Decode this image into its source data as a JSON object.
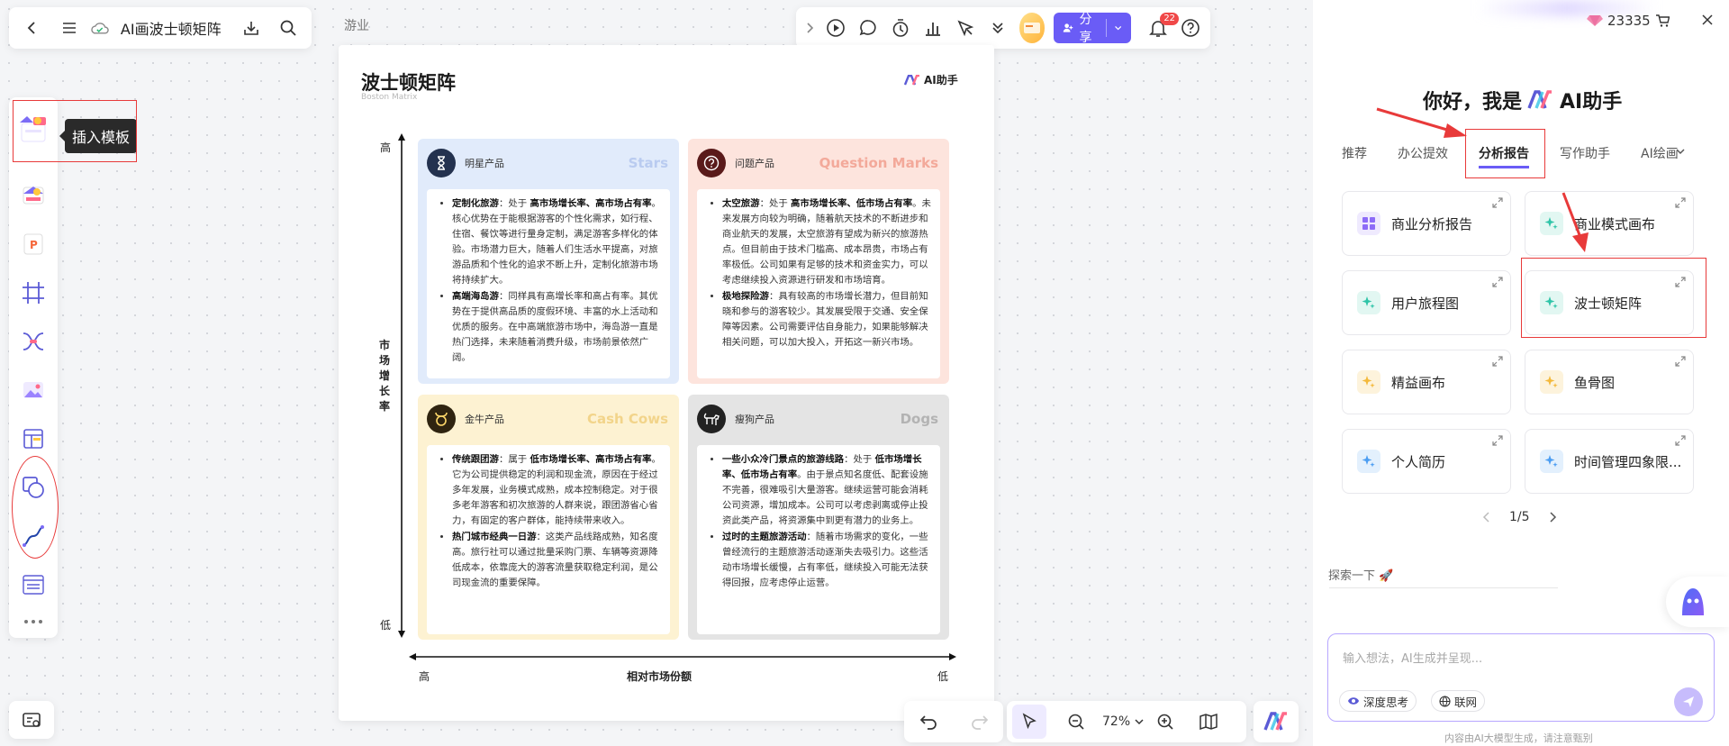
{
  "app": {
    "doc_title": "AI画波士顿矩阵",
    "behind_text": "游业"
  },
  "toolbar": {
    "share_label": "分享",
    "notification_count": "22"
  },
  "left_toolbar": {
    "tooltip": "插入模板"
  },
  "board": {
    "title": "波士顿矩阵",
    "subtitle": "Boston Matrix",
    "logo_text": "AI助手",
    "y_axis_label": "市场增长率",
    "y_high": "高",
    "y_low": "低",
    "x_axis_label": "相对市场份额",
    "x_high": "高",
    "x_low": "低",
    "quadrants": {
      "stars": {
        "name": "明星产品",
        "en": "Stars",
        "items": [
          {
            "title": "定制化旅游",
            "lead": "：处于 ",
            "highlight": "高市场增长率、高市场占有率",
            "rest": "。核心优势在于能根据游客的个性化需求，如行程、住宿、餐饮等进行量身定制，满足游客多样化的体验。市场潜力巨大，随着人们生活水平提高，对旅游品质和个性化的追求不断上升，定制化旅游市场将持续扩大。"
          },
          {
            "title": "高端海岛游",
            "lead": "：同样具有高增长率和高占有率。其优势在于提供高品质的度假环境、丰富的水上活动和优质的服务。在中高端旅游市场中，海岛游一直是热门选择，未来随着消费升级，市场前景依然广阔。",
            "highlight": "",
            "rest": ""
          }
        ]
      },
      "question_marks": {
        "name": "问题产品",
        "en": "Question Marks",
        "items": [
          {
            "title": "太空旅游",
            "lead": "：处于 ",
            "highlight": "高市场增长率、低市场占有率",
            "rest": "。未来发展方向较为明确，随着航天技术的不断进步和商业航天的发展，太空旅游有望成为新兴的旅游热点。但目前由于技术门槛高、成本昂贵，市场占有率极低。公司如果有足够的技术和资金实力，可以考虑继续投入资源进行研发和市场培育。"
          },
          {
            "title": "极地探险游",
            "lead": "：具有较高的市场增长潜力，但目前知晓和参与的游客较少。其发展受限于交通、安全保障等因素。公司需要评估自身能力，如果能够解决相关问题，可以加大投入，开拓这一新兴市场。",
            "highlight": "",
            "rest": ""
          }
        ]
      },
      "cash_cows": {
        "name": "金牛产品",
        "en": "Cash Cows",
        "items": [
          {
            "title": "传统跟团游",
            "lead": "：属于 ",
            "highlight": "低市场增长率、高市场占有率",
            "rest": "。它为公司提供稳定的利润和现金流，原因在于经过多年发展，业务模式成熟，成本控制稳定。对于很多老年游客和初次旅游的人群来说，跟团游省心省力，有固定的客户群体，能持续带来收入。"
          },
          {
            "title": "热门城市经典一日游",
            "lead": "：这类产品线路成熟，知名度高。旅行社可以通过批量采购门票、车辆等资源降低成本，依靠庞大的游客流量获取稳定利润，是公司现金流的重要保障。",
            "highlight": "",
            "rest": ""
          }
        ]
      },
      "dogs": {
        "name": "瘦狗产品",
        "en": "Dogs",
        "items": [
          {
            "title": "一些小众冷门景点的旅游线路",
            "lead": "：处于 ",
            "highlight": "低市场增长率、低市场占有率",
            "rest": "。由于景点知名度低、配套设施不完善，很难吸引大量游客。继续运营可能会消耗公司资源，增加成本。公司可以考虑剥离或停止投资此类产品，将资源集中到更有潜力的业务上。"
          },
          {
            "title": "过时的主题旅游活动",
            "lead": "：随着市场需求的变化，一些曾经流行的主题旅游活动逐渐失去吸引力。这些活动市场增长缓慢，占有率低，继续投入可能无法获得回报，应考虑停止运营。",
            "highlight": "",
            "rest": ""
          }
        ]
      }
    }
  },
  "bottom": {
    "zoom": "72%"
  },
  "panel": {
    "points": "23335",
    "greeting_prefix": "你好，我是",
    "greeting_name": "AI助手",
    "tabs": [
      "推荐",
      "办公提效",
      "分析报告",
      "写作助手",
      "AI绘画"
    ],
    "active_tab": "分析报告",
    "cards": [
      {
        "label": "商业分析报告",
        "color": "#8d6cf7",
        "bg": "#efeafe"
      },
      {
        "label": "商业模式画布",
        "color": "#2fc4a8",
        "bg": "#e2f7f2"
      },
      {
        "label": "用户旅程图",
        "color": "#2fc4a8",
        "bg": "#e2f7f2"
      },
      {
        "label": "波士顿矩阵",
        "color": "#2fc4a8",
        "bg": "#e2f7f2"
      },
      {
        "label": "精益画布",
        "color": "#f4b93b",
        "bg": "#fdf3dc"
      },
      {
        "label": "鱼骨图",
        "color": "#f4b93b",
        "bg": "#fdf3dc"
      },
      {
        "label": "个人简历",
        "color": "#4b9df2",
        "bg": "#e3f0fd"
      },
      {
        "label": "时间管理四象限...",
        " color": "#4b9df2",
        "bg": "#e3f0fd"
      }
    ],
    "pager": "1/5",
    "explore": "探索一下",
    "input_placeholder": "输入想法，AI生成并呈现...",
    "chip_deep": "深度思考",
    "chip_web": "联网",
    "disclaimer": "内容由AI大模型生成，请注意甄别"
  }
}
